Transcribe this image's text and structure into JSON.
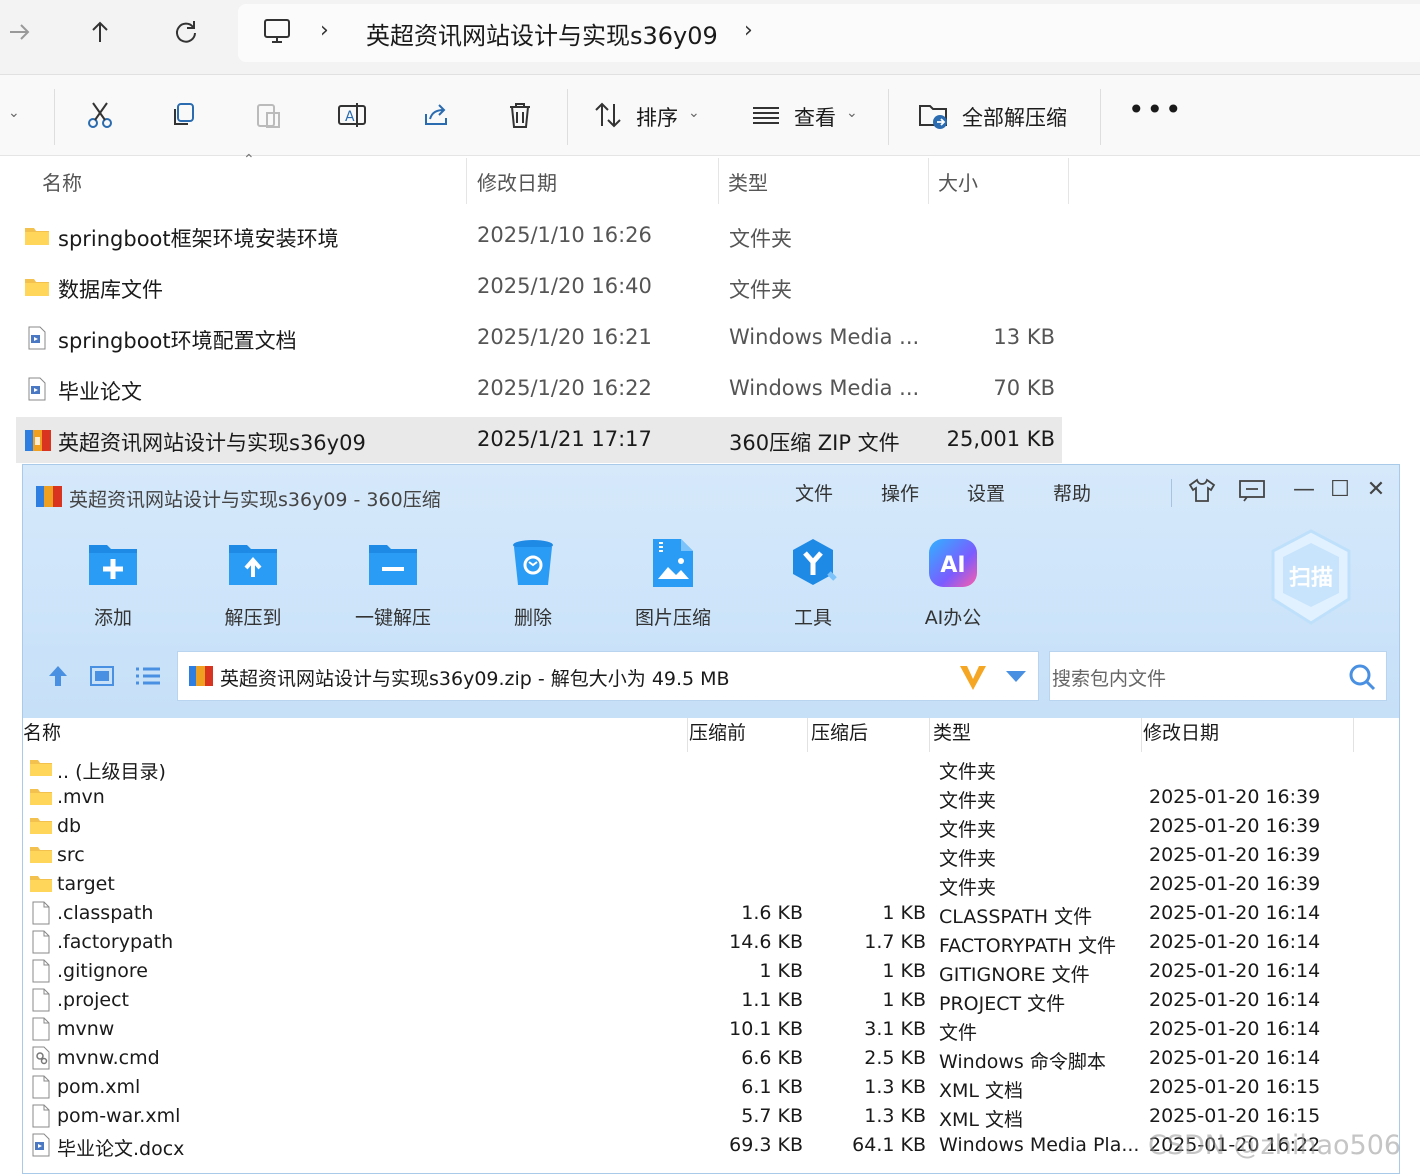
{
  "explorer": {
    "breadcrumb": "英超资讯网站设计与实现s36y09",
    "toolbar": {
      "sort_label": "排序",
      "view_label": "查看",
      "extract_all_label": "全部解压缩"
    },
    "columns": [
      "名称",
      "修改日期",
      "类型",
      "大小"
    ],
    "rows": [
      {
        "name": "springboot框架环境安装环境",
        "date": "2025/1/10 16:26",
        "type": "文件夹",
        "size": "",
        "icon": "folder-icon"
      },
      {
        "name": "数据库文件",
        "date": "2025/1/20 16:40",
        "type": "文件夹",
        "size": "",
        "icon": "folder-icon"
      },
      {
        "name": "springboot环境配置文档",
        "date": "2025/1/20 16:21",
        "type": "Windows Media ...",
        "size": "13 KB",
        "icon": "document-icon"
      },
      {
        "name": "毕业论文",
        "date": "2025/1/20 16:22",
        "type": "Windows Media ...",
        "size": "70 KB",
        "icon": "document-icon"
      },
      {
        "name": "英超资讯网站设计与实现s36y09",
        "date": "2025/1/21 17:17",
        "type": "360压缩 ZIP 文件",
        "size": "25,001 KB",
        "icon": "zip-archive-icon",
        "selected": true
      }
    ]
  },
  "archiver": {
    "title": "英超资讯网站设计与实现s36y09 - 360压缩",
    "menu": [
      "文件",
      "操作",
      "设置",
      "帮助"
    ],
    "tools": [
      {
        "label": "添加",
        "icon": "add-icon"
      },
      {
        "label": "解压到",
        "icon": "extract-to-icon"
      },
      {
        "label": "一键解压",
        "icon": "one-click-extract-icon"
      },
      {
        "label": "删除",
        "icon": "delete-icon"
      },
      {
        "label": "图片压缩",
        "icon": "image-compress-icon"
      },
      {
        "label": "工具",
        "icon": "tools-icon"
      },
      {
        "label": "AI办公",
        "icon": "ai-office-icon"
      }
    ],
    "scan_label": "扫描",
    "ai_badge": "AI",
    "path_text": "英超资讯网站设计与实现s36y09.zip - 解包大小为 49.5 MB",
    "search_placeholder": "搜索包内文件",
    "columns": [
      "名称",
      "压缩前",
      "压缩后",
      "类型",
      "修改日期"
    ],
    "rows": [
      {
        "name": ".. (上级目录)",
        "before": "",
        "after": "",
        "type": "文件夹",
        "date": "",
        "icon": "folder-icon"
      },
      {
        "name": ".mvn",
        "before": "",
        "after": "",
        "type": "文件夹",
        "date": "2025-01-20 16:39",
        "icon": "folder-icon"
      },
      {
        "name": "db",
        "before": "",
        "after": "",
        "type": "文件夹",
        "date": "2025-01-20 16:39",
        "icon": "folder-icon"
      },
      {
        "name": "src",
        "before": "",
        "after": "",
        "type": "文件夹",
        "date": "2025-01-20 16:39",
        "icon": "folder-icon"
      },
      {
        "name": "target",
        "before": "",
        "after": "",
        "type": "文件夹",
        "date": "2025-01-20 16:39",
        "icon": "folder-icon"
      },
      {
        "name": ".classpath",
        "before": "1.6 KB",
        "after": "1 KB",
        "type": "CLASSPATH 文件",
        "date": "2025-01-20 16:14",
        "icon": "file-icon"
      },
      {
        "name": ".factorypath",
        "before": "14.6 KB",
        "after": "1.7 KB",
        "type": "FACTORYPATH 文件",
        "date": "2025-01-20 16:14",
        "icon": "file-icon"
      },
      {
        "name": ".gitignore",
        "before": "1 KB",
        "after": "1 KB",
        "type": "GITIGNORE 文件",
        "date": "2025-01-20 16:14",
        "icon": "file-icon"
      },
      {
        "name": ".project",
        "before": "1.1 KB",
        "after": "1 KB",
        "type": "PROJECT 文件",
        "date": "2025-01-20 16:14",
        "icon": "file-icon"
      },
      {
        "name": "mvnw",
        "before": "10.1 KB",
        "after": "3.1 KB",
        "type": "文件",
        "date": "2025-01-20 16:14",
        "icon": "file-icon"
      },
      {
        "name": "mvnw.cmd",
        "before": "6.6 KB",
        "after": "2.5 KB",
        "type": "Windows 命令脚本",
        "date": "2025-01-20 16:14",
        "icon": "script-icon"
      },
      {
        "name": "pom.xml",
        "before": "6.1 KB",
        "after": "1.3 KB",
        "type": "XML 文档",
        "date": "2025-01-20 16:15",
        "icon": "file-icon"
      },
      {
        "name": "pom-war.xml",
        "before": "5.7 KB",
        "after": "1.3 KB",
        "type": "XML 文档",
        "date": "2025-01-20 16:15",
        "icon": "file-icon"
      },
      {
        "name": "毕业论文.docx",
        "before": "69.3 KB",
        "after": "64.1 KB",
        "type": "Windows Media Pla...",
        "date": "2025-01-20 16:22",
        "icon": "document-icon"
      }
    ]
  },
  "watermark": "CSDN @zhihao506"
}
